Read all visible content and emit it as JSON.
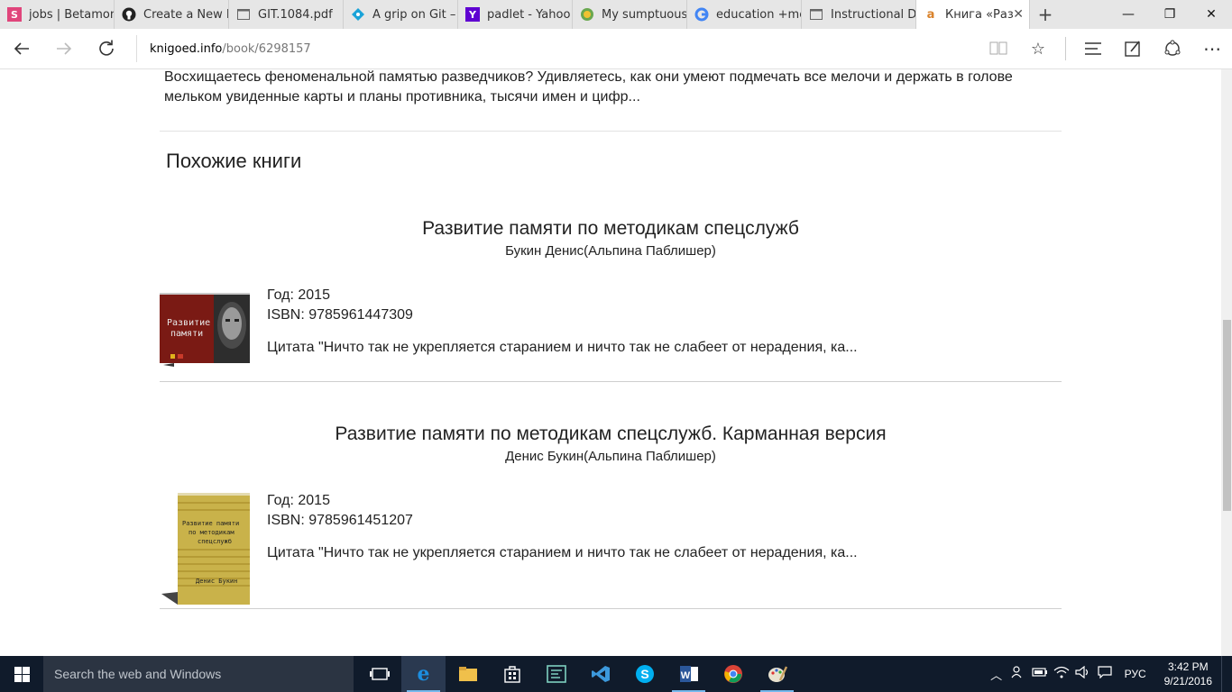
{
  "browser": {
    "tabs": [
      {
        "title": "jobs | Betamon",
        "icon": "betamon-icon",
        "color": "#e0457b"
      },
      {
        "title": "Create a New F",
        "icon": "github-icon",
        "color": "#222222"
      },
      {
        "title": "GIT.1084.pdf",
        "icon": "pdf-page-icon",
        "color": "#666666"
      },
      {
        "title": "A grip on Git –",
        "icon": "diamond-icon",
        "color": "#1aa3d8"
      },
      {
        "title": "padlet - Yahoo",
        "icon": "yahoo-icon",
        "color": "#5f01d1"
      },
      {
        "title": "My sumptuous",
        "icon": "globe-icon",
        "color": "#6aa84f"
      },
      {
        "title": "education +me",
        "icon": "google-icon",
        "color": "#4285f4"
      },
      {
        "title": "Instructional De",
        "icon": "page-icon",
        "color": "#666666"
      },
      {
        "title": "Книга «Раз",
        "icon": "knigoed-icon",
        "color": "#d9822b"
      }
    ],
    "new_tab": "+",
    "address": {
      "host": "knigoed.info",
      "path": "/book/6298157"
    }
  },
  "page": {
    "description": "Восхищаетесь феноменальной памятью разведчиков? Удивляетесь, как они умеют подмечать все мелочи и держать в голове мельком увиденные карты и планы противника, тысячи имен и цифр...",
    "similar_heading": "Похожие книги",
    "books": [
      {
        "title": "Развитие памяти по методикам спецслужб",
        "author": "Букин Денис(Альпина Паблишер)",
        "year": "Год: 2015",
        "isbn": "ISBN: 9785961447309",
        "quote": "Цитата \"Ничто так не укрепляется старанием и ничто так не слабеет от нерадения, ка...",
        "cover_text_1": "Развитие",
        "cover_text_2": "памяти"
      },
      {
        "title": "Развитие памяти по методикам спецслужб. Карманная версия",
        "author": "Денис Букин(Альпина Паблишер)",
        "year": "Год: 2015",
        "isbn": "ISBN: 9785961451207",
        "quote": "Цитата \"Ничто так не укрепляется старанием и ничто так не слабеет от нерадения, ка...",
        "cover_text_1": "Развитие памяти",
        "cover_text_2": "по методикам",
        "cover_text_3": "спецслужб",
        "cover_text_4": "Денис Букин"
      }
    ]
  },
  "taskbar": {
    "search_placeholder": "Search the web and Windows",
    "language": "РУС",
    "time": "3:42 PM",
    "date": "9/21/2016"
  },
  "colors": {
    "taskbar_bg": "#101b2b",
    "tab_strip_bg": "#e6e6e6",
    "edge_blue": "#1c8ee0"
  }
}
